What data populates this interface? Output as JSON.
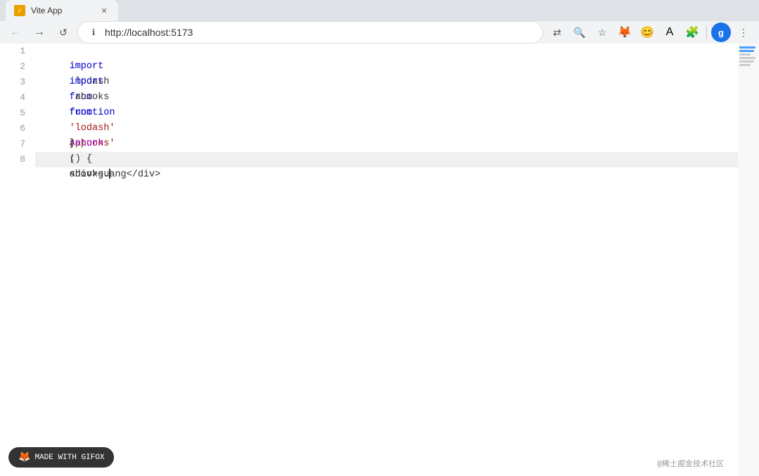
{
  "browser": {
    "url": "http://localhost:5173",
    "tab_title": "Vite App",
    "back_label": "←",
    "forward_label": "→",
    "reload_label": "↺",
    "info_label": "ℹ",
    "profile_label": "g",
    "more_label": "⋮",
    "translate_label": "⇄",
    "zoom_label": "🔍",
    "bookmark_label": "☆",
    "ext1_label": "🦊",
    "ext2_label": "😊",
    "ext3_label": "A",
    "ext4_label": "🧩"
  },
  "watermark": {
    "label": "MADE WITH GIFOX"
  },
  "bottom_right": {
    "text": "@稀土掘金技术社区"
  },
  "code": {
    "lines": [
      {
        "num": "1",
        "content": "import lodash from 'lodash';"
      },
      {
        "num": "2",
        "content": "import ahooks from 'ahooks';"
      },
      {
        "num": "3",
        "content": ""
      },
      {
        "num": "4",
        "content": "function App() {"
      },
      {
        "num": "5",
        "content": "  return <div>guang</div>"
      },
      {
        "num": "6",
        "content": "}"
      },
      {
        "num": "7",
        "content": ""
      },
      {
        "num": "8",
        "content": "ahooks."
      }
    ]
  }
}
